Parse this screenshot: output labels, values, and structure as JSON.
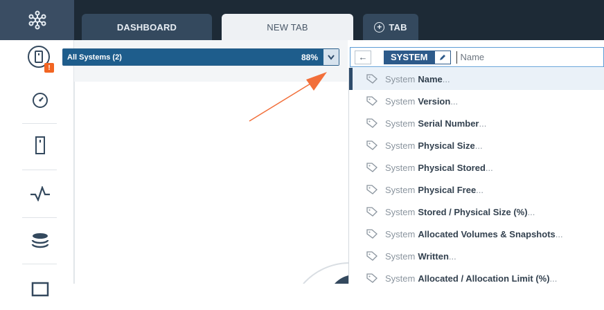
{
  "tabs": [
    {
      "label": "DASHBOARD"
    },
    {
      "label": "NEW TAB"
    },
    {
      "label": "TAB"
    }
  ],
  "scope": {
    "label": "All Systems (2)",
    "percent": "88%"
  },
  "query": {
    "chip": "SYSTEM",
    "placeholder": "Name"
  },
  "warning_badge": "!",
  "dropdown": [
    {
      "prefix": "System",
      "name": "Name",
      "suffix": "..."
    },
    {
      "prefix": "System",
      "name": "Version",
      "suffix": "..."
    },
    {
      "prefix": "System",
      "name": "Serial Number",
      "suffix": "..."
    },
    {
      "prefix": "System",
      "name": "Physical Size",
      "suffix": "..."
    },
    {
      "prefix": "System",
      "name": "Physical Stored",
      "suffix": "..."
    },
    {
      "prefix": "System",
      "name": "Physical Free",
      "suffix": "..."
    },
    {
      "prefix": "System",
      "name": "Stored / Physical Size (%)",
      "suffix": "..."
    },
    {
      "prefix": "System",
      "name": "Allocated Volumes & Snapshots",
      "suffix": "..."
    },
    {
      "prefix": "System",
      "name": "Written",
      "suffix": "..."
    },
    {
      "prefix": "System",
      "name": "Allocated / Allocation Limit (%)",
      "suffix": "..."
    }
  ],
  "icons": [
    "network-logo-icon",
    "plus-circle-icon",
    "system-icon",
    "warning-icon",
    "gauge-icon",
    "storage-device-icon",
    "activity-icon",
    "database-icon",
    "monitor-icon",
    "chevron-down-icon",
    "back-arrow-icon",
    "pencil-icon",
    "tag-icon",
    "annotation-arrow"
  ],
  "colors": {
    "accent": "#1e5d8c",
    "warning": "#f26522",
    "annotation": "#f26f3a"
  }
}
